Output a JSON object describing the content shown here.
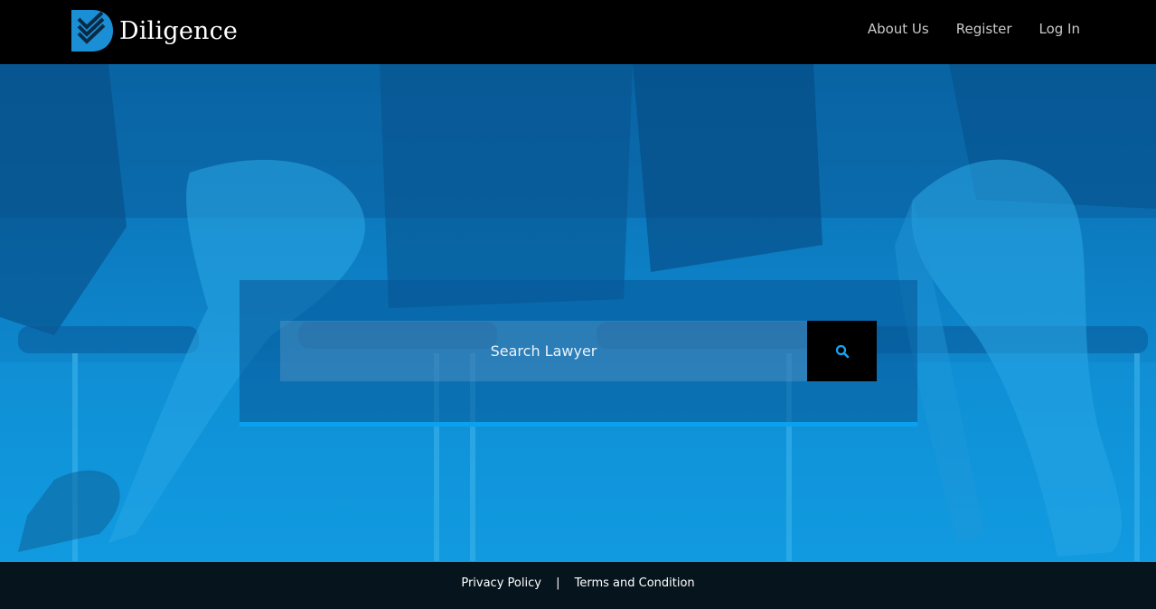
{
  "brand": {
    "name": "Diligence",
    "accent_color": "#0aa2ee",
    "logo_icon": "diligence-checkmark-logo-icon"
  },
  "nav": {
    "items": [
      {
        "label": "About Us"
      },
      {
        "label": "Register"
      },
      {
        "label": "Log In"
      }
    ]
  },
  "search": {
    "placeholder": "Search Lawyer",
    "value": "",
    "button_icon": "search-icon"
  },
  "footer": {
    "privacy_label": "Privacy Policy",
    "separator": "|",
    "terms_label": "Terms and Condition"
  }
}
